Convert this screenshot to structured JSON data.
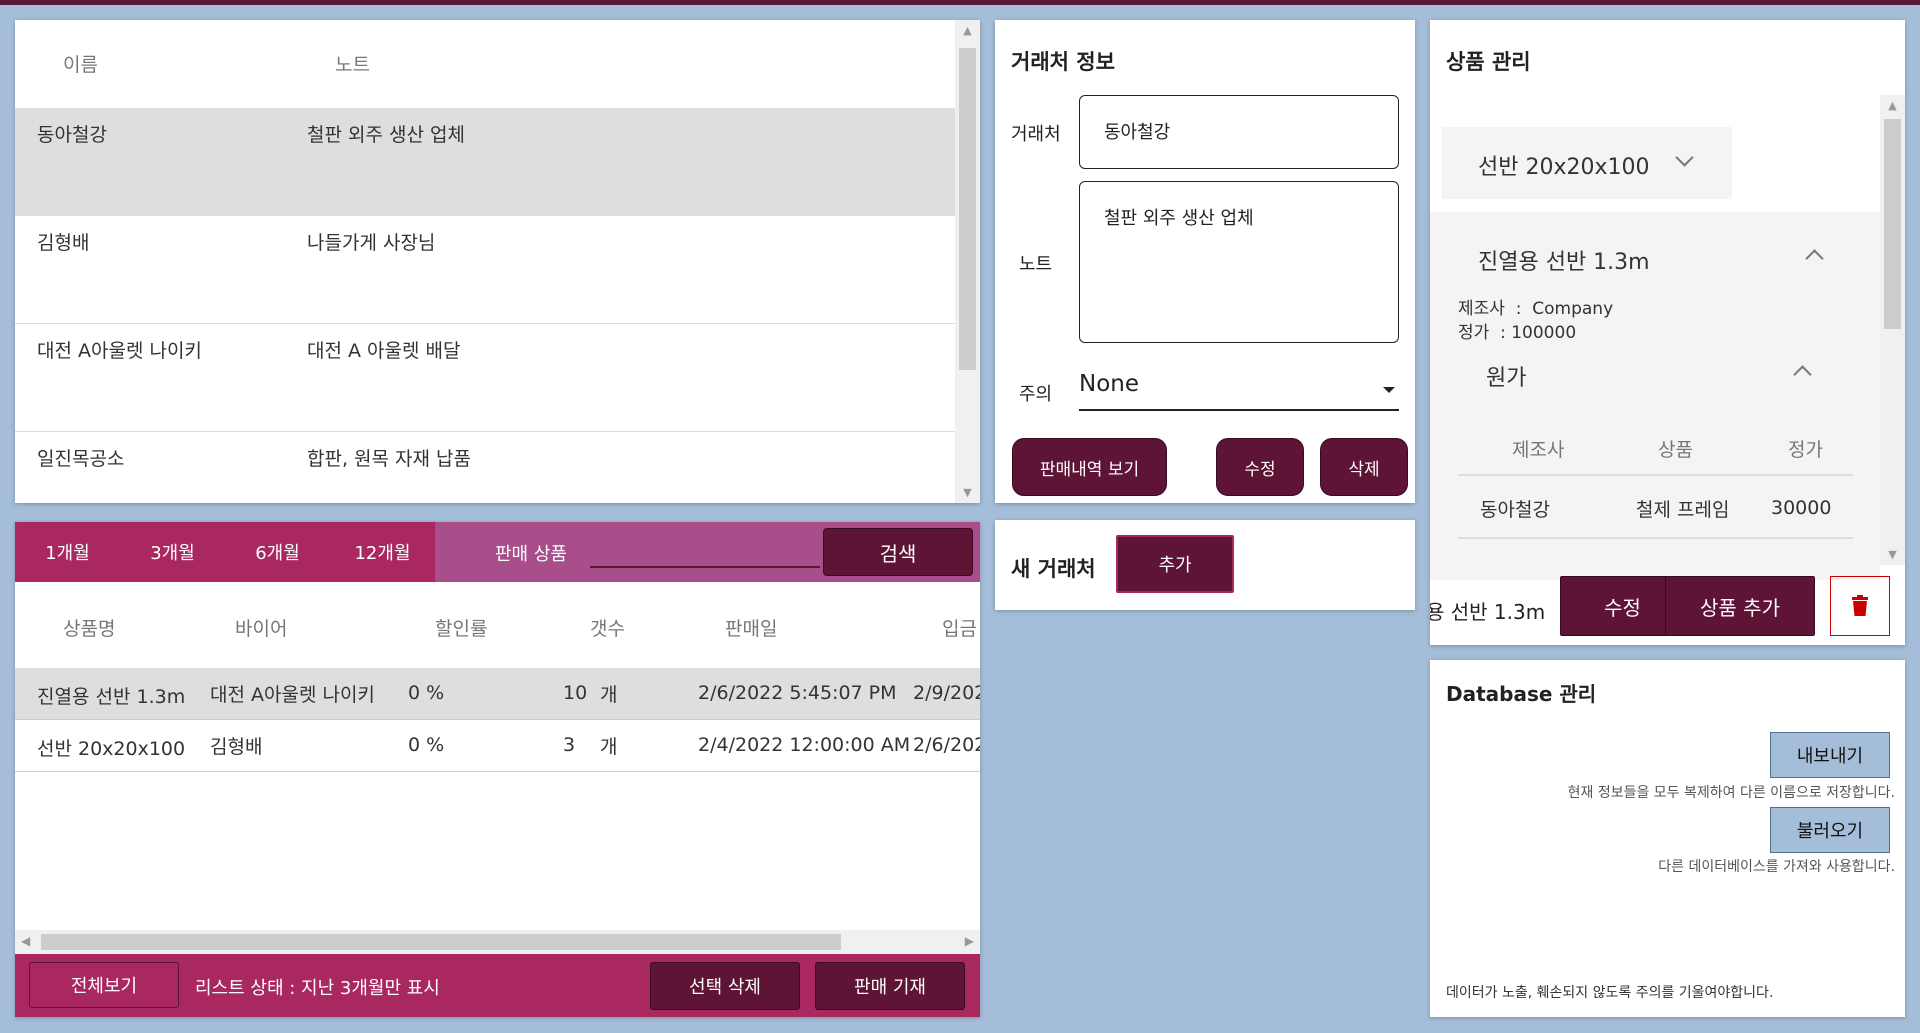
{
  "clients": {
    "headers": {
      "name": "이름",
      "note": "노트"
    },
    "rows": [
      {
        "name": "동아철강",
        "note": "철판 외주 생산 업체"
      },
      {
        "name": "김형배",
        "note": "나들가게 사장님"
      },
      {
        "name": "대전 A아울렛 나이키",
        "note": "대전 A 아울렛 배달"
      },
      {
        "name": "일진목공소",
        "note": "합판, 원목 자재 납품"
      }
    ]
  },
  "sales": {
    "periods": [
      "1개월",
      "3개월",
      "6개월",
      "12개월"
    ],
    "search_label": "판매 상품",
    "search_value": "",
    "search_button": "검색",
    "headers": [
      "상품명",
      "바이어",
      "할인률",
      "갯수",
      "판매일",
      "입금"
    ],
    "rows": [
      {
        "product": "진열용 선반 1.3m",
        "buyer": "대전 A아울렛 나이키",
        "discount": "0 %",
        "qty": "10",
        "unit": "개",
        "date": "2/6/2022 5:45:07 PM",
        "paid": "2/9/202"
      },
      {
        "product": "선반 20x20x100",
        "buyer": "김형배",
        "discount": "0 %",
        "qty": "3",
        "unit": "개",
        "date": "2/4/2022 12:00:00 AM",
        "paid": "2/6/202"
      }
    ],
    "show_all": "전체보기",
    "status": "리스트 상태 : 지난 3개월만 표시",
    "delete_selected": "선택 삭제",
    "record_sale": "판매 기재"
  },
  "client_info": {
    "title": "거래처 정보",
    "client_label": "거래처",
    "client_value": "동아철강",
    "note_label": "노트",
    "note_value": "철판 외주 생산 업체",
    "caution_label": "주의",
    "caution_value": "None",
    "history_button": "판매내역 보기",
    "edit_button": "수정",
    "delete_button": "삭제"
  },
  "new_client": {
    "title": "새 거래처",
    "add_button": "추가"
  },
  "product_mgmt": {
    "title": "상품 관리",
    "selected_product": "선반 20x20x100",
    "expanded_product": "진열용 선반 1.3m",
    "maker_label": "제조사",
    "maker_value": "Company",
    "price_label": "정가",
    "price_value": "100000",
    "cost_title": "원가",
    "cost_headers": [
      "제조사",
      "상품",
      "정가"
    ],
    "cost_rows": [
      {
        "maker": "동아철강",
        "product": "철제 프레임",
        "price": "30000"
      }
    ],
    "footer_text": "용 선반 1.3m",
    "edit_button": "수정",
    "add_product_button": "상품 추가",
    "trash_icon": "trash-icon",
    "accent": "#cc0000"
  },
  "database": {
    "title": "Database 관리",
    "export_button": "내보내기",
    "export_desc": "현재 정보들을 모두 복제하여 다른 이름으로 저장합니다.",
    "import_button": "불러오기",
    "import_desc": "다른 데이터베이스를 가져와 사용합니다.",
    "warning": "데이터가 노출, 훼손되지 않도록 주의를 기울여야합니다."
  },
  "colors": {
    "background": "#a4bdd8",
    "dark": "#5d1435",
    "magenta": "#a8285f",
    "tab_bar": "#a74e8b"
  }
}
